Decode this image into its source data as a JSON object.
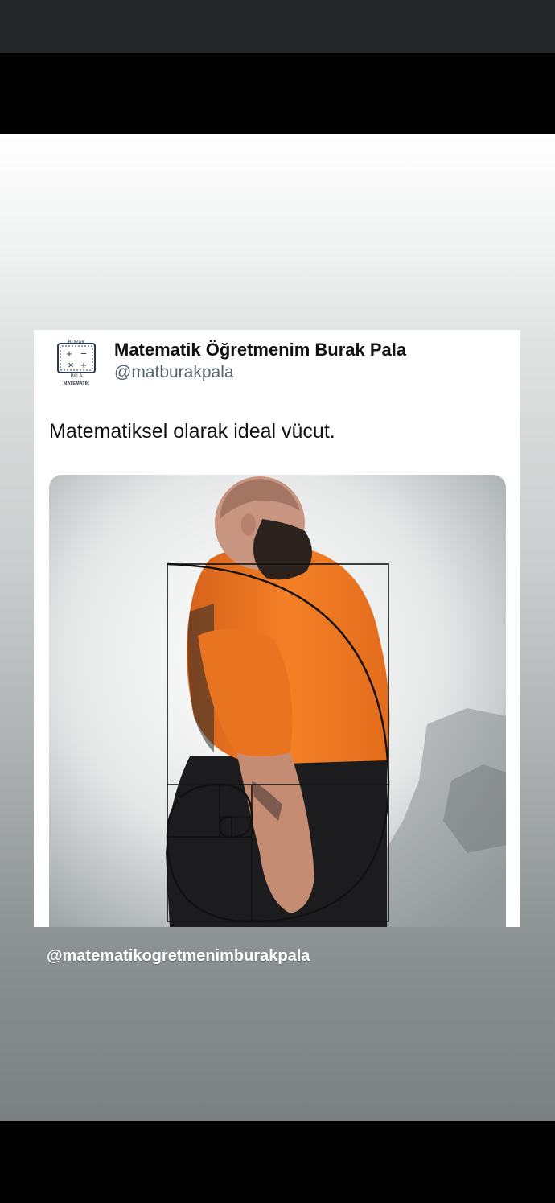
{
  "tweet": {
    "display_name": "Matematik Öğretmenim Burak Pala",
    "handle": "@matburakpala",
    "text": "Matematiksel olarak ideal vücut.",
    "avatar": {
      "icon": "math-logo-icon",
      "top_text": "BURAK",
      "bottom_text": "PALA",
      "caption": "MATEMATİK",
      "symbols": [
        "+",
        "−",
        "×",
        "+"
      ]
    },
    "photo": {
      "icon": "golden-spiral-man-photo"
    }
  },
  "story": {
    "watermark": "@matematikogretmenimburakpala"
  },
  "colors": {
    "shirt": "#f07a22",
    "top_bar": "#252628",
    "handle": "#536471"
  }
}
